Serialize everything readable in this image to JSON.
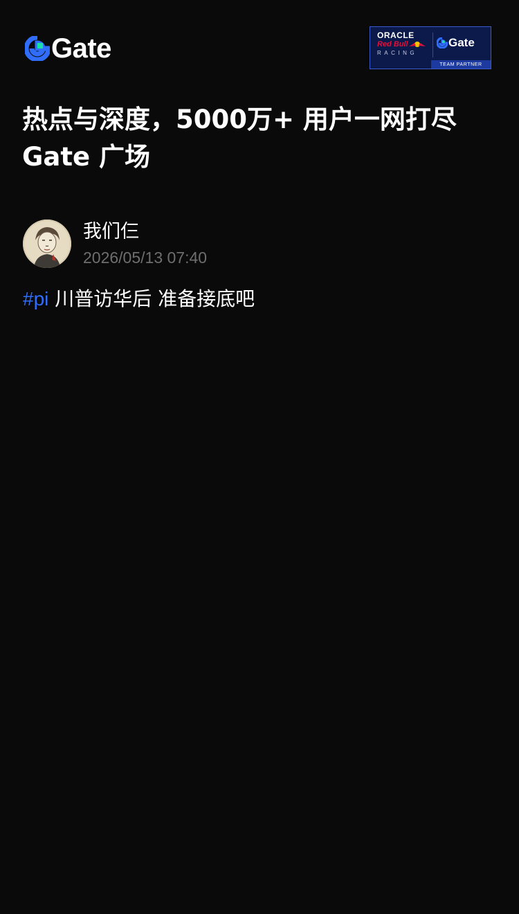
{
  "header": {
    "logo_text": "Gate",
    "logo_icon": "gate-logo-icon",
    "partner": {
      "oracle": "ORACLE",
      "redbull": "Red Bull",
      "racing": "RACING",
      "gate": "Gate",
      "team_partner": "TEAM PARTNER"
    }
  },
  "headline": {
    "line1": "热点与深度，5000万+ 用户一网打尽",
    "line2": "Gate 广场"
  },
  "post": {
    "author_name": "我们仨",
    "timestamp": "2026/05/13 07:40",
    "hashtag": "#pi",
    "text": " 川普访华后 准备接底吧"
  },
  "colors": {
    "background": "#0a0a0a",
    "hashtag": "#2f6dfa",
    "timestamp": "#6e6e6e",
    "badge_bg": "#0b1a4a"
  }
}
